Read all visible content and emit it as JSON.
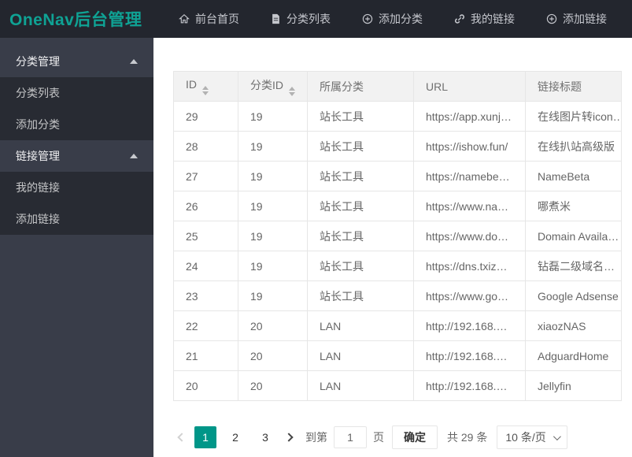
{
  "brand": {
    "title": "OneNav后台管理",
    "color": "#0FA294"
  },
  "accent_color": "#009688",
  "topnav": {
    "items": [
      {
        "label": "前台首页",
        "icon": "home-icon"
      },
      {
        "label": "分类列表",
        "icon": "list-icon"
      },
      {
        "label": "添加分类",
        "icon": "plus-circle-icon"
      },
      {
        "label": "我的链接",
        "icon": "link-icon"
      },
      {
        "label": "添加链接",
        "icon": "plus-circle-icon"
      }
    ]
  },
  "sidebar": {
    "sections": [
      {
        "label": "分类管理",
        "expanded": true,
        "children": [
          {
            "label": "分类列表"
          },
          {
            "label": "添加分类"
          }
        ]
      },
      {
        "label": "链接管理",
        "expanded": true,
        "children": [
          {
            "label": "我的链接"
          },
          {
            "label": "添加链接"
          }
        ]
      }
    ]
  },
  "table": {
    "columns": [
      {
        "label": "ID",
        "sortable": true
      },
      {
        "label": "分类ID",
        "sortable": true
      },
      {
        "label": "所属分类",
        "sortable": false
      },
      {
        "label": "URL",
        "sortable": false
      },
      {
        "label": "链接标题",
        "sortable": false
      }
    ],
    "rows": [
      [
        "29",
        "19",
        "站长工具",
        "https://app.xunj…",
        "在线图片转icon…"
      ],
      [
        "28",
        "19",
        "站长工具",
        "https://ishow.fun/",
        "在线扒站高级版"
      ],
      [
        "27",
        "19",
        "站长工具",
        "https://namebe…",
        "NameBeta"
      ],
      [
        "26",
        "19",
        "站长工具",
        "https://www.na…",
        "哪煮米"
      ],
      [
        "25",
        "19",
        "站长工具",
        "https://www.do…",
        "Domain Availa…"
      ],
      [
        "24",
        "19",
        "站长工具",
        "https://dns.txiz…",
        "钻磊二级域名…"
      ],
      [
        "23",
        "19",
        "站长工具",
        "https://www.go…",
        "Google Adsense"
      ],
      [
        "22",
        "20",
        "LAN",
        "http://192.168.…",
        "xiaozNAS"
      ],
      [
        "21",
        "20",
        "LAN",
        "http://192.168.…",
        "AdguardHome"
      ],
      [
        "20",
        "20",
        "LAN",
        "http://192.168.…",
        "Jellyfin"
      ]
    ]
  },
  "pagination": {
    "pages": [
      "1",
      "2",
      "3"
    ],
    "active_page": "1",
    "goto_label": "到第",
    "goto_value": "1",
    "page_unit": "页",
    "confirm_label": "确定",
    "total_label": "共 29 条",
    "page_size": "10 条/页"
  }
}
